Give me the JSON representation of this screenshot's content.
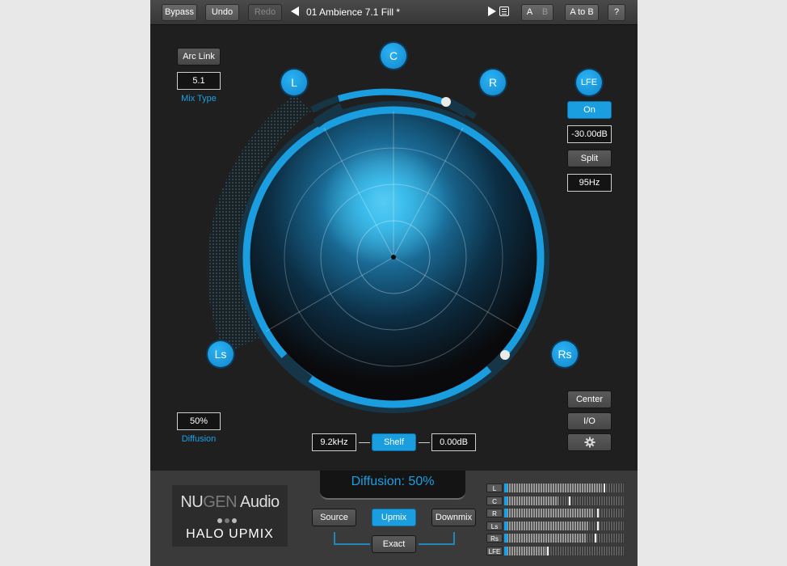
{
  "toolbar": {
    "bypass": "Bypass",
    "undo": "Undo",
    "redo": "Redo",
    "preset_name": "01 Ambience 7.1 Fill *",
    "ab_a": "A",
    "ab_b": "B",
    "a_to_b": "A to B",
    "help": "?"
  },
  "left_panel": {
    "arc_link": "Arc Link",
    "mix_type_value": "5.1",
    "mix_type_label": "Mix Type",
    "diffusion_value": "50%",
    "diffusion_label": "Diffusion"
  },
  "speakers": {
    "l": "L",
    "c": "C",
    "r": "R",
    "ls": "Ls",
    "rs": "Rs",
    "lfe": "LFE"
  },
  "lfe_panel": {
    "on": "On",
    "gain": "-30.00dB",
    "split": "Split",
    "freq": "95Hz"
  },
  "right_lower": {
    "center": "Center",
    "io": "I/O",
    "settings_icon": "gear-icon"
  },
  "shelf": {
    "freq": "9.2kHz",
    "label": "Shelf",
    "gain": "0.00dB"
  },
  "bottom": {
    "diffusion_readout": "Diffusion: 50%",
    "logo_nu": "NU",
    "logo_gen": "GEN",
    "logo_audio": " Audio",
    "product": "HALO UPMIX",
    "source": "Source",
    "upmix": "Upmix",
    "downmix": "Downmix",
    "exact": "Exact"
  },
  "meters": [
    {
      "label": "L",
      "level": 0.82,
      "peak": 0.83
    },
    {
      "label": "C",
      "level": 0.45,
      "peak": 0.54
    },
    {
      "label": "R",
      "level": 0.74,
      "peak": 0.78
    },
    {
      "label": "Ls",
      "level": 0.7,
      "peak": 0.78
    },
    {
      "label": "Rs",
      "level": 0.69,
      "peak": 0.76
    },
    {
      "label": "LFE",
      "level": 0.35,
      "peak": 0.36
    }
  ],
  "colors": {
    "accent": "#1aa0e6",
    "panel": "#1f1f1f",
    "background": "#e8e8e8"
  }
}
